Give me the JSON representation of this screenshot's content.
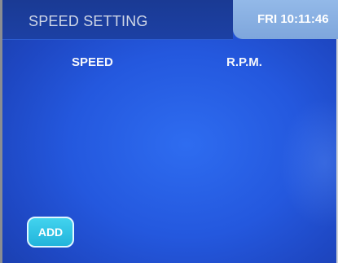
{
  "header": {
    "title": "SPEED SETTING",
    "clock": "FRI 10:11:46"
  },
  "table": {
    "columns": [
      "SPEED",
      "R.P.M."
    ]
  },
  "actions": {
    "add_label": "ADD"
  },
  "colors": {
    "background": "#2458de",
    "clock_tab": "#8ab0e2",
    "add_button": "#2fc3e6"
  }
}
